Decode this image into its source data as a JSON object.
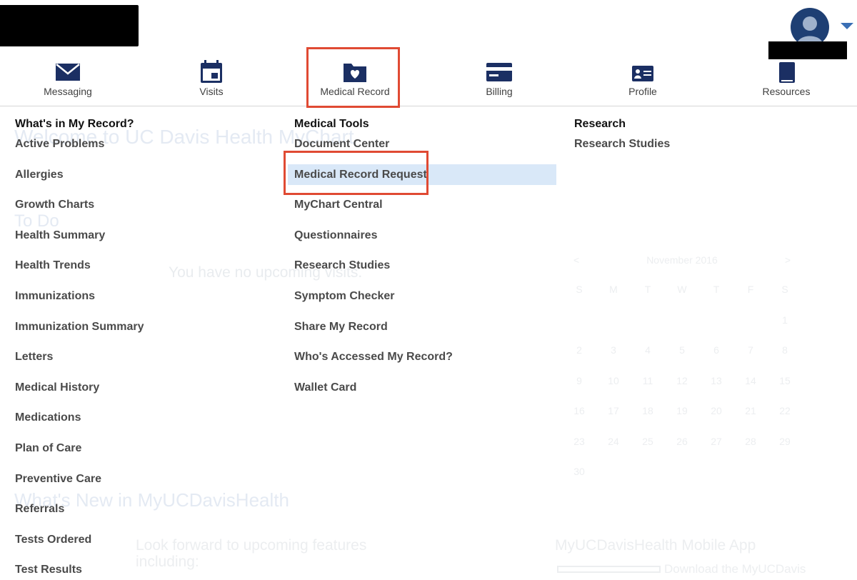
{
  "nav": {
    "items": [
      {
        "label": "Messaging",
        "icon": "envelope-icon"
      },
      {
        "label": "Visits",
        "icon": "calendar-icon"
      },
      {
        "label": "Medical Record",
        "icon": "folder-heart-icon"
      },
      {
        "label": "Billing",
        "icon": "credit-card-icon"
      },
      {
        "label": "Profile",
        "icon": "id-card-icon"
      },
      {
        "label": "Resources",
        "icon": "book-icon"
      }
    ]
  },
  "menu": {
    "col1": {
      "heading": "What's in My Record?",
      "links": [
        "Active Problems",
        "Allergies",
        "Growth Charts",
        "Health Summary",
        "Health Trends",
        "Immunizations",
        "Immunization Summary",
        "Letters",
        "Medical History",
        "Medications",
        "Plan of Care",
        "Preventive Care",
        "Referrals",
        "Tests Ordered",
        "Test Results"
      ]
    },
    "col2": {
      "heading": "Medical Tools",
      "links": [
        "Document Center",
        "Medical Record Request",
        "MyChart Central",
        "Questionnaires",
        "Research Studies",
        "Symptom Checker",
        "Share My Record",
        "Who's Accessed My Record?",
        "Wallet Card"
      ]
    },
    "col3": {
      "heading": "Research",
      "links": [
        "Research Studies"
      ]
    }
  },
  "background": {
    "welcome": "Welcome to UC Davis Health MyChart",
    "todo": "To Do",
    "no_appointments": "You have no upcoming visits.",
    "whats_new": "What's New in MyUCDavisHealth",
    "look_forward": [
      "Look forward to upcoming features",
      "including:"
    ],
    "mobile_app": "MyUCDavisHealth Mobile App",
    "download": "Download the MyUCDavis",
    "calendar": {
      "month": "November 2016",
      "prev": "<",
      "next": ">",
      "weekdays": [
        "S",
        "M",
        "T",
        "W",
        "T",
        "F",
        "S"
      ],
      "weeks": [
        [
          "",
          "",
          "",
          "",
          "",
          "",
          "1"
        ],
        [
          "2",
          "3",
          "4",
          "5",
          "6",
          "7",
          "8"
        ],
        [
          "9",
          "10",
          "11",
          "12",
          "13",
          "14",
          "15"
        ],
        [
          "16",
          "17",
          "18",
          "19",
          "20",
          "21",
          "22"
        ],
        [
          "23",
          "24",
          "25",
          "26",
          "27",
          "28",
          "29"
        ],
        [
          "30",
          "",
          "",
          "",
          "",
          "",
          ""
        ]
      ]
    }
  },
  "colors": {
    "brand_navy": "#1b2f63",
    "highlight_red": "#e04a33",
    "active_row": "#d9e8f8"
  }
}
